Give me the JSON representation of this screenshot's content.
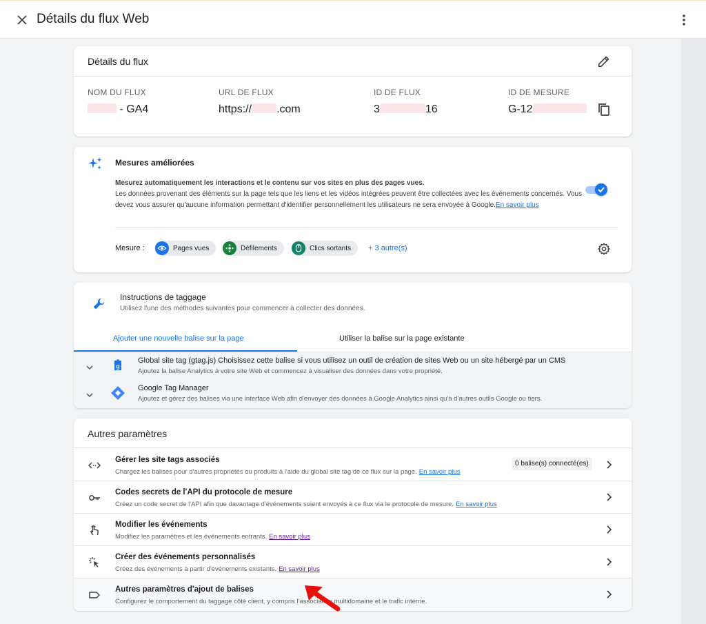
{
  "topbar": {
    "title": "Détails du flux Web",
    "close_icon": "close-icon",
    "menu_icon": "more-vert-icon"
  },
  "stream_details": {
    "title": "Détails du flux",
    "columns": [
      {
        "label": "NOM DU FLUX",
        "value_suffix": " - GA4"
      },
      {
        "label": "URL DE FLUX",
        "value_prefix": "https://",
        "value_suffix": ".com"
      },
      {
        "label": "ID DE FLUX",
        "value_prefix": "3",
        "value_suffix": "16"
      },
      {
        "label": "ID DE MESURE",
        "value_prefix": "G-12"
      }
    ]
  },
  "enhanced": {
    "title": "Mesures améliorées",
    "line1": "Mesurez automatiquement les interactions et le contenu sur vos sites en plus des pages vues.",
    "line2": "Les données provenant des éléments sur la page tels que les liens et les vidéos intégrées peuvent être collectées avec les événements concernés. Vous devez vous assurer qu'aucune information permettant d'identifier personnellement les utilisateurs ne sera envoyée à Google.",
    "link": "En savoir plus",
    "toggle_on": true,
    "measure_label": "Mesure :",
    "chips": [
      {
        "label": "Pages vues",
        "icon": "eye-icon",
        "color": "#1a73e8"
      },
      {
        "label": "Défilements",
        "icon": "scroll-icon",
        "color": "#188038"
      },
      {
        "label": "Clics sortants",
        "icon": "mouse-icon",
        "color": "#12836b"
      }
    ],
    "more": "+ 3 autre(s)"
  },
  "tagging": {
    "title": "Instructions de taggage",
    "subtitle": "Utilisez l'une des méthodes suivantes pour commencer à collecter des données.",
    "tabs": [
      {
        "label": "Ajouter une nouvelle balise sur la page",
        "active": true
      },
      {
        "label": "Utiliser la balise sur la page existante",
        "active": false
      }
    ],
    "rows": [
      {
        "title": "Global site tag (gtag.js) Choisissez cette balise si vous utilisez un outil de création de sites Web ou un site hébergé par un CMS",
        "desc": "Ajoutez la balise Analytics à votre site Web et commencez à visualiser des données dans votre propriété."
      },
      {
        "title": "Google Tag Manager",
        "desc": "Ajoutez et gérez des balises via une interface Web afin d'envoyer des données à Google Analytics ainsi qu'à d'autres outils Google ou tiers."
      }
    ]
  },
  "other": {
    "title": "Autres paramètres",
    "rows": [
      {
        "title": "Gérer les site tags associés",
        "desc": "Chargez les balises pour d'autres propriétés ou produits à l'aide du global site tag de ce flux sur la page.",
        "link": "En savoir plus",
        "badge": "0 balise(s) connecté(es)"
      },
      {
        "title": "Codes secrets de l'API du protocole de mesure",
        "desc": "Créez un code secret de l'API afin que davantage d'événements soient envoyés à ce flux via le protocole de mesure.",
        "link": "En savoir plus"
      },
      {
        "title": "Modifier les événements",
        "desc": "Modifiez les paramètres et les événements entrants.",
        "link": "En savoir plus"
      },
      {
        "title": "Créer des événements personnalisés",
        "desc": "Créez des événements à partir d'événements existants.",
        "link": "En savoir plus"
      },
      {
        "title": "Autres paramètres d'ajout de balises",
        "desc": "Configurez le comportement du taggage côté client, y compris l'association multidomaine et le trafic interne."
      }
    ]
  },
  "colors": {
    "accent": "#1a73e8",
    "annotation": "#e8100c"
  }
}
